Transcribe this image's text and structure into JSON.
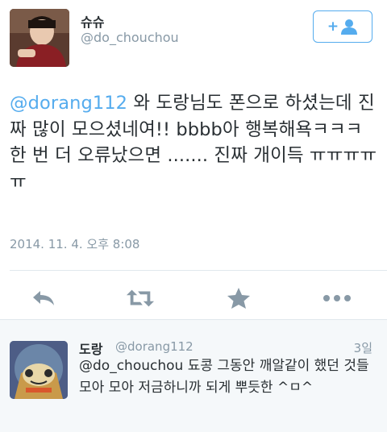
{
  "tweet": {
    "author_name": "슈슈",
    "author_handle": "@do_chouchou",
    "text_mention": "@dorang112",
    "text_body": " 와 도랑님도 폰으로 하셨는데 진짜 많이 모으셨네여!! bbbb아 행복해욕ㅋㅋㅋ 한 번 더 오류났으면 ....... 진짜 개이득 ㅠㅠㅠㅠㅠ",
    "timestamp": "2014. 11. 4. 오후 8:08"
  },
  "follow_button": {
    "icon": "follow-icon"
  },
  "actions": [
    {
      "name": "reply",
      "icon": "reply-icon"
    },
    {
      "name": "retweet",
      "icon": "retweet-icon"
    },
    {
      "name": "favorite",
      "icon": "star-icon"
    },
    {
      "name": "more",
      "icon": "more-icon"
    }
  ],
  "reply": {
    "author_name": "도랑",
    "author_handle": "@dorang112",
    "time": "3일",
    "text": "@do_chouchou 됴콩 그동안 깨알같이 했던 것들 모아 모아 저금하니까 되게 뿌듯한 ^ㅁ^"
  },
  "colors": {
    "accent": "#55acee",
    "icon_gray": "#8899a6",
    "text": "#292f33",
    "reply_bg": "#f5f8fa"
  }
}
